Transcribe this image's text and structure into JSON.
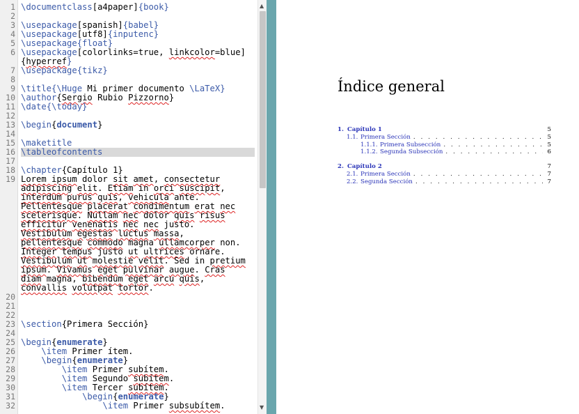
{
  "editor": {
    "lines": [
      {
        "num": "1",
        "segments": [
          {
            "t": "\\documentclass",
            "c": "k"
          },
          {
            "t": "[a4paper]"
          },
          {
            "t": "{book}",
            "c": "k"
          }
        ]
      },
      {
        "num": "2",
        "segments": []
      },
      {
        "num": "3",
        "segments": [
          {
            "t": "\\usepackage",
            "c": "k"
          },
          {
            "t": "[spanish]"
          },
          {
            "t": "{babel}",
            "c": "k"
          }
        ]
      },
      {
        "num": "4",
        "segments": [
          {
            "t": "\\usepackage",
            "c": "k"
          },
          {
            "t": "[utf8]"
          },
          {
            "t": "{inputenc}",
            "c": "k"
          }
        ]
      },
      {
        "num": "5",
        "segments": [
          {
            "t": "\\usepackage",
            "c": "k"
          },
          {
            "t": "{float}",
            "c": "k"
          }
        ]
      },
      {
        "num": "6",
        "segments": [
          {
            "t": "\\usepackage",
            "c": "k"
          },
          {
            "t": "[colorlinks=true, "
          },
          {
            "t": "linkcolor",
            "c": "sq"
          },
          {
            "t": "=blue]"
          },
          {
            "t": "\n{"
          },
          {
            "t": "hyperref",
            "c": "sq"
          },
          {
            "t": "}",
            "c": "k"
          }
        ],
        "rows": 2
      },
      {
        "num": "7",
        "segments": [
          {
            "t": "\\usepackage",
            "c": "k"
          },
          {
            "t": "{tikz}",
            "c": "k"
          }
        ]
      },
      {
        "num": "8",
        "segments": []
      },
      {
        "num": "9",
        "segments": [
          {
            "t": "\\title",
            "c": "k"
          },
          {
            "t": "{\\Huge",
            "c": "k"
          },
          {
            "t": " Mi primer documento "
          },
          {
            "t": "\\LaTeX",
            "c": "k"
          },
          {
            "t": "}",
            "c": "k"
          }
        ]
      },
      {
        "num": "10",
        "segments": [
          {
            "t": "\\author",
            "c": "k"
          },
          {
            "t": "{"
          },
          {
            "t": "Sergio",
            "c": "sq"
          },
          {
            "t": " Rubio "
          },
          {
            "t": "Pizzorno",
            "c": "sq"
          },
          {
            "t": "}"
          }
        ]
      },
      {
        "num": "11",
        "segments": [
          {
            "t": "\\date",
            "c": "k"
          },
          {
            "t": "{\\today}",
            "c": "k"
          }
        ]
      },
      {
        "num": "12",
        "segments": []
      },
      {
        "num": "13",
        "segments": [
          {
            "t": "\\begin",
            "c": "k"
          },
          {
            "t": "{"
          },
          {
            "t": "document",
            "c": "b"
          },
          {
            "t": "}"
          }
        ]
      },
      {
        "num": "14",
        "segments": []
      },
      {
        "num": "15",
        "segments": [
          {
            "t": "\\maketitle",
            "c": "k"
          }
        ]
      },
      {
        "num": "16",
        "segments": [
          {
            "t": "\\tableofcontents",
            "c": "k"
          }
        ],
        "highlight": true
      },
      {
        "num": "17",
        "segments": []
      },
      {
        "num": "18",
        "segments": [
          {
            "t": "\\chapter",
            "c": "k"
          },
          {
            "t": "{Capítulo 1}"
          }
        ]
      },
      {
        "num": "19",
        "segments": [
          {
            "t": "Lorem ",
            "c": "sq"
          },
          {
            "t": "ipsum",
            "c": "sq"
          },
          {
            "t": " dolor "
          },
          {
            "t": "sit",
            "c": "sq"
          },
          {
            "t": " "
          },
          {
            "t": "amet",
            "c": "sq"
          },
          {
            "t": ", "
          },
          {
            "t": "consectetur",
            "c": "sq"
          },
          {
            "t": "\n"
          },
          {
            "t": "adipiscing",
            "c": "sq"
          },
          {
            "t": " "
          },
          {
            "t": "elit",
            "c": "sq"
          },
          {
            "t": ". "
          },
          {
            "t": "Etiam",
            "c": "sq"
          },
          {
            "t": " in "
          },
          {
            "t": "orci",
            "c": "sq"
          },
          {
            "t": " "
          },
          {
            "t": "suscipit",
            "c": "sq"
          },
          {
            "t": ","
          },
          {
            "t": "\n"
          },
          {
            "t": "interdum",
            "c": "sq"
          },
          {
            "t": " "
          },
          {
            "t": "purus",
            "c": "sq"
          },
          {
            "t": " "
          },
          {
            "t": "quis",
            "c": "sq"
          },
          {
            "t": ", "
          },
          {
            "t": "vehicula",
            "c": "sq"
          },
          {
            "t": " ante."
          },
          {
            "t": "\n"
          },
          {
            "t": "Pellentesque",
            "c": "sq"
          },
          {
            "t": " "
          },
          {
            "t": "placerat",
            "c": "sq"
          },
          {
            "t": " "
          },
          {
            "t": "condimentum",
            "c": "sq"
          },
          {
            "t": " "
          },
          {
            "t": "erat",
            "c": "sq"
          },
          {
            "t": " "
          },
          {
            "t": "nec",
            "c": "sq"
          },
          {
            "t": "\n"
          },
          {
            "t": "scelerisque",
            "c": "sq"
          },
          {
            "t": ". "
          },
          {
            "t": "Nullam",
            "c": "sq"
          },
          {
            "t": " "
          },
          {
            "t": "nec",
            "c": "sq"
          },
          {
            "t": " dolor "
          },
          {
            "t": "quis",
            "c": "sq"
          },
          {
            "t": " "
          },
          {
            "t": "risus",
            "c": "sq"
          },
          {
            "t": "\n"
          },
          {
            "t": "efficitur",
            "c": "sq"
          },
          {
            "t": " "
          },
          {
            "t": "venenatis",
            "c": "sq"
          },
          {
            "t": " "
          },
          {
            "t": "nec",
            "c": "sq"
          },
          {
            "t": " "
          },
          {
            "t": "nec",
            "c": "sq"
          },
          {
            "t": " justo."
          },
          {
            "t": "\n"
          },
          {
            "t": "Vestibulum",
            "c": "sq"
          },
          {
            "t": " "
          },
          {
            "t": "egestas",
            "c": "sq"
          },
          {
            "t": " "
          },
          {
            "t": "luctus",
            "c": "sq"
          },
          {
            "t": " "
          },
          {
            "t": "massa",
            "c": "sq"
          },
          {
            "t": ","
          },
          {
            "t": "\n"
          },
          {
            "t": "pellentesque",
            "c": "sq"
          },
          {
            "t": " "
          },
          {
            "t": "commodo",
            "c": "sq"
          },
          {
            "t": " magna "
          },
          {
            "t": "ullamcorper",
            "c": "sq"
          },
          {
            "t": " non."
          },
          {
            "t": "\n"
          },
          {
            "t": "Integer",
            "c": "sq"
          },
          {
            "t": " "
          },
          {
            "t": "tempus",
            "c": "sq"
          },
          {
            "t": " justo "
          },
          {
            "t": "ut",
            "c": "sq"
          },
          {
            "t": " "
          },
          {
            "t": "ultrices",
            "c": "sq"
          },
          {
            "t": " ornare."
          },
          {
            "t": "\n"
          },
          {
            "t": "Vestibulum",
            "c": "sq"
          },
          {
            "t": " "
          },
          {
            "t": "ut",
            "c": "sq"
          },
          {
            "t": " "
          },
          {
            "t": "molestie",
            "c": "sq"
          },
          {
            "t": " "
          },
          {
            "t": "velit",
            "c": "sq"
          },
          {
            "t": ". Sed in "
          },
          {
            "t": "pretium",
            "c": "sq"
          },
          {
            "t": "\n"
          },
          {
            "t": "ipsum",
            "c": "sq"
          },
          {
            "t": ". "
          },
          {
            "t": "Vivamus",
            "c": "sq"
          },
          {
            "t": " "
          },
          {
            "t": "eget",
            "c": "sq"
          },
          {
            "t": " "
          },
          {
            "t": "pulvinar",
            "c": "sq"
          },
          {
            "t": " "
          },
          {
            "t": "augue",
            "c": "sq"
          },
          {
            "t": ". "
          },
          {
            "t": "Cras",
            "c": "sq"
          },
          {
            "t": "\n"
          },
          {
            "t": "diam",
            "c": "sq"
          },
          {
            "t": " magna, "
          },
          {
            "t": "bibendum",
            "c": "sq"
          },
          {
            "t": " "
          },
          {
            "t": "eget",
            "c": "sq"
          },
          {
            "t": " "
          },
          {
            "t": "arcu",
            "c": "sq"
          },
          {
            "t": " "
          },
          {
            "t": "quis",
            "c": "sq"
          },
          {
            "t": ","
          },
          {
            "t": "\n"
          },
          {
            "t": "convallis",
            "c": "sq"
          },
          {
            "t": " "
          },
          {
            "t": "volutpat",
            "c": "sq"
          },
          {
            "t": " "
          },
          {
            "t": "tortor",
            "c": "sq"
          },
          {
            "t": "."
          }
        ],
        "rows": 13
      },
      {
        "num": "20",
        "segments": []
      },
      {
        "num": "21",
        "segments": []
      },
      {
        "num": "22",
        "segments": []
      },
      {
        "num": "23",
        "segments": [
          {
            "t": "\\section",
            "c": "k"
          },
          {
            "t": "{Primera Sección}"
          }
        ]
      },
      {
        "num": "24",
        "segments": []
      },
      {
        "num": "25",
        "segments": [
          {
            "t": "\\begin",
            "c": "k"
          },
          {
            "t": "{"
          },
          {
            "t": "enumerate",
            "c": "b"
          },
          {
            "t": "}"
          }
        ]
      },
      {
        "num": "26",
        "segments": [
          {
            "t": "    "
          },
          {
            "t": "\\item",
            "c": "k"
          },
          {
            "t": " Primer ítem."
          }
        ]
      },
      {
        "num": "27",
        "segments": [
          {
            "t": "    "
          },
          {
            "t": "\\begin",
            "c": "k"
          },
          {
            "t": "{"
          },
          {
            "t": "enumerate",
            "c": "b"
          },
          {
            "t": "}"
          }
        ]
      },
      {
        "num": "28",
        "segments": [
          {
            "t": "        "
          },
          {
            "t": "\\item",
            "c": "k"
          },
          {
            "t": " Primer "
          },
          {
            "t": "subítem",
            "c": "sq"
          },
          {
            "t": "."
          }
        ]
      },
      {
        "num": "29",
        "segments": [
          {
            "t": "        "
          },
          {
            "t": "\\item",
            "c": "k"
          },
          {
            "t": " Segundo "
          },
          {
            "t": "subítem",
            "c": "sq"
          },
          {
            "t": "."
          }
        ]
      },
      {
        "num": "30",
        "segments": [
          {
            "t": "        "
          },
          {
            "t": "\\item",
            "c": "k"
          },
          {
            "t": " Tercer "
          },
          {
            "t": "subítem",
            "c": "sq"
          },
          {
            "t": "."
          }
        ]
      },
      {
        "num": "31",
        "segments": [
          {
            "t": "            "
          },
          {
            "t": "\\begin",
            "c": "k"
          },
          {
            "t": "{"
          },
          {
            "t": "enumerate",
            "c": "b"
          },
          {
            "t": "}"
          }
        ]
      },
      {
        "num": "32",
        "segments": [
          {
            "t": "                "
          },
          {
            "t": "\\item",
            "c": "k"
          },
          {
            "t": " Primer "
          },
          {
            "t": "subsubítem",
            "c": "sq"
          },
          {
            "t": "."
          }
        ]
      }
    ],
    "scroll_up_icon": "▲",
    "scroll_down_icon": "▼"
  },
  "pdf": {
    "title": "Índice general",
    "toc": [
      {
        "num": "1.",
        "label": "Capítulo 1",
        "page": "5",
        "level": 0
      },
      {
        "num": "1.1.",
        "label": "Primera Sección",
        "page": "5",
        "level": 1
      },
      {
        "num": "1.1.1.",
        "label": "Primera Subsección",
        "page": "5",
        "level": 2
      },
      {
        "num": "1.1.2.",
        "label": "Segunda Subsección",
        "page": "6",
        "level": 2
      },
      {
        "num": "2.",
        "label": "Capítulo 2",
        "page": "7",
        "level": 0
      },
      {
        "num": "2.1.",
        "label": "Primera Sección",
        "page": "7",
        "level": 1
      },
      {
        "num": "2.2.",
        "label": "Segunda Sección",
        "page": "7",
        "level": 1
      }
    ],
    "link_color": "#2b35b8"
  }
}
